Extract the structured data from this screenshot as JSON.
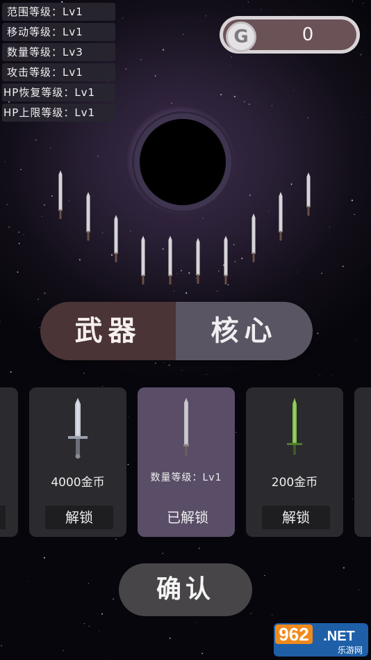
{
  "stats": [
    {
      "label": "范围等级：Lv1"
    },
    {
      "label": "移动等级：Lv1"
    },
    {
      "label": "数量等级：Lv3"
    },
    {
      "label": "攻击等级：Lv1"
    },
    {
      "label": "HP恢复等级：Lv1"
    },
    {
      "label": "HP上限等级：Lv1"
    }
  ],
  "coins": {
    "icon_letter": "G",
    "value": "0",
    "icon": "coin-icon"
  },
  "tabs": {
    "weapon": "武器",
    "core": "核心",
    "active": "weapon"
  },
  "cards": [
    {
      "price": "4000金币",
      "button": "解锁",
      "sword_color": "#c9ccd6",
      "guard": "cross"
    },
    {
      "level": "数量等级：Lv1",
      "button": "已解锁",
      "sword_color": "#bfbfc2",
      "selected": true
    },
    {
      "price": "200金币",
      "button": "解锁",
      "sword_color": "#7fc24a",
      "guard": "cross"
    }
  ],
  "confirm": "确认",
  "watermark": {
    "brand": "962",
    "suffix": ".NET",
    "sub": "乐游网"
  },
  "colors": {
    "weapon_tab": "#4a3436",
    "core_tab": "#5a5562",
    "selected_card": "#5a4d67"
  }
}
